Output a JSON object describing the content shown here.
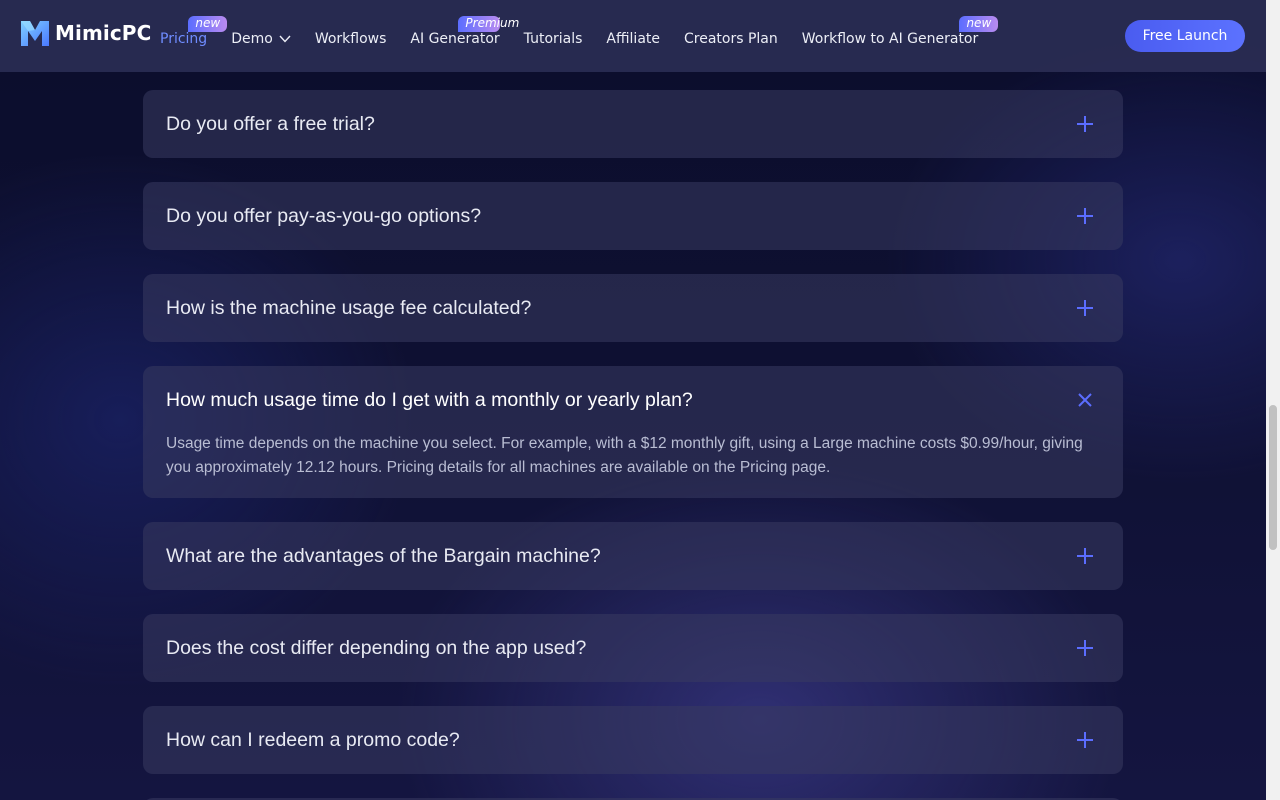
{
  "brand": {
    "name": "MimicPC",
    "accent": "#5b6dff"
  },
  "nav": {
    "items": [
      {
        "label": "Pricing",
        "badge": "new",
        "active": true
      },
      {
        "label": "Demo",
        "dropdown": true
      },
      {
        "label": "Workflows"
      },
      {
        "label": "AI Generator",
        "badge": "Premium"
      },
      {
        "label": "Tutorials"
      },
      {
        "label": "Affiliate"
      },
      {
        "label": "Creators Plan"
      },
      {
        "label": "Workflow to AI Generator",
        "badge": "new"
      }
    ],
    "cta": "Free Launch"
  },
  "faq": {
    "items": [
      {
        "question": "Do you offer a free trial?",
        "icon": "plus-icon"
      },
      {
        "question": "Do you offer pay-as-you-go options?",
        "icon": "plus-icon"
      },
      {
        "question": "How is the machine usage fee calculated?",
        "icon": "plus-icon"
      },
      {
        "question": "How much usage time do I get with a monthly or yearly plan?",
        "icon": "close-icon",
        "answer": "Usage time depends on the machine you select. For example, with a $12 monthly gift, using a Large machine costs $0.99/hour, giving you approximately 12.12 hours. Pricing details for all machines are available on the Pricing page."
      },
      {
        "question": "What are the advantages of the Bargain machine?",
        "icon": "plus-icon"
      },
      {
        "question": "Does the cost differ depending on the app used?",
        "icon": "plus-icon"
      },
      {
        "question": "How can I redeem a promo code?",
        "icon": "plus-icon"
      }
    ]
  }
}
